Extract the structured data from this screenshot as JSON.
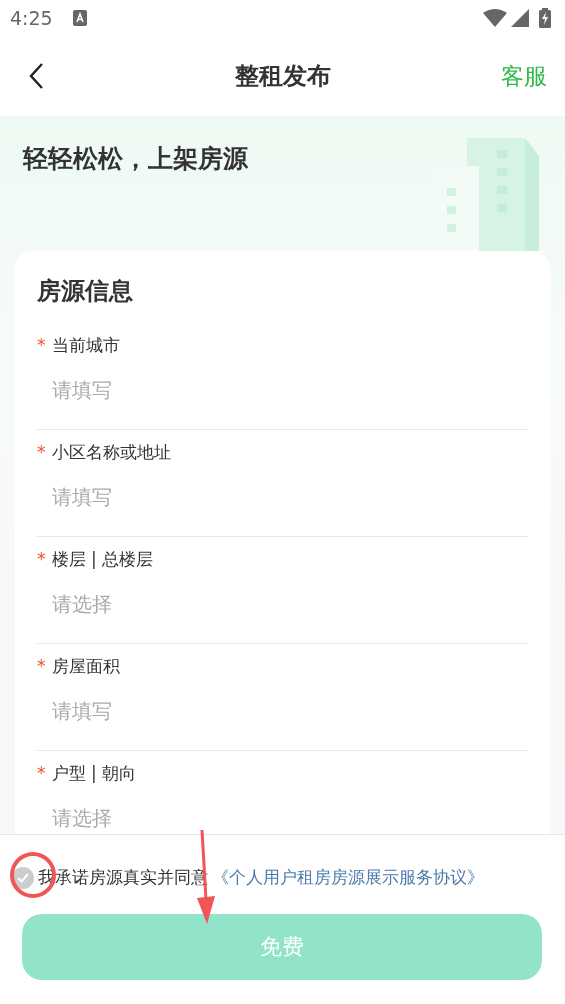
{
  "status_bar": {
    "time": "4:25"
  },
  "nav": {
    "title": "整租发布",
    "action": "客服"
  },
  "hero": {
    "heading": "轻轻松松，上架房源"
  },
  "form": {
    "title": "房源信息",
    "fields": [
      {
        "required_mark": "*",
        "label": "当前城市",
        "placeholder": "请填写"
      },
      {
        "required_mark": "*",
        "label": "小区名称或地址",
        "placeholder": "请填写"
      },
      {
        "required_mark": "*",
        "label": "楼层 | 总楼层",
        "placeholder": "请选择"
      },
      {
        "required_mark": "*",
        "label": "房屋面积",
        "placeholder": "请填写"
      },
      {
        "required_mark": "*",
        "label": "户型 | 朝向",
        "placeholder": "请选择"
      }
    ]
  },
  "agreement": {
    "checked": false,
    "text": "我承诺房源真实并同意",
    "link": "《个人用户租房房源展示服务协议》"
  },
  "submit": {
    "label": "免费"
  }
}
